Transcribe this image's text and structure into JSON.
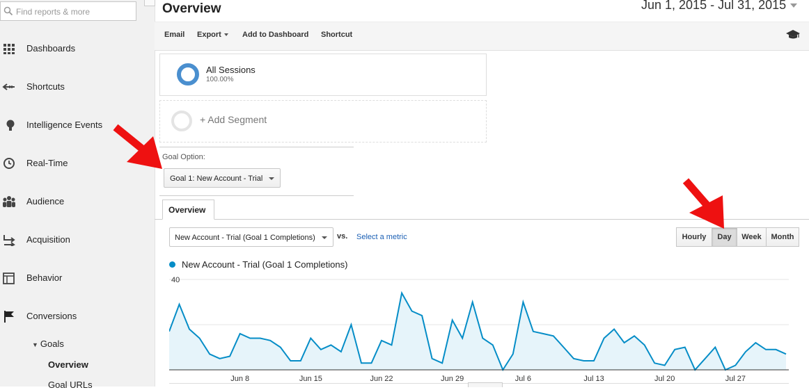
{
  "sidebar": {
    "search_placeholder": "Find reports & more",
    "items": [
      {
        "label": "Dashboards",
        "icon": "grid-icon"
      },
      {
        "label": "Shortcuts",
        "icon": "shortcut-arrow-icon"
      },
      {
        "label": "Intelligence Events",
        "icon": "lightbulb-icon"
      },
      {
        "label": "Real-Time",
        "icon": "clock-icon"
      },
      {
        "label": "Audience",
        "icon": "people-icon"
      },
      {
        "label": "Acquisition",
        "icon": "arrows-icon"
      },
      {
        "label": "Behavior",
        "icon": "layout-icon"
      },
      {
        "label": "Conversions",
        "icon": "flag-icon"
      }
    ],
    "goals_label": "Goals",
    "goals_items": [
      "Overview",
      "Goal URLs"
    ]
  },
  "header": {
    "title": "Overview",
    "date_range": "Jun 1, 2015 - Jul 31, 2015"
  },
  "toolbar": {
    "email": "Email",
    "export": "Export",
    "add_to_dashboard": "Add to Dashboard",
    "shortcut": "Shortcut"
  },
  "segments": {
    "all_sessions": "All Sessions",
    "all_sessions_pct": "100.00%",
    "add_segment": "+ Add Segment"
  },
  "goal_option": {
    "label": "Goal Option:",
    "value": "Goal 1: New Account - Trial"
  },
  "tabs": {
    "overview": "Overview"
  },
  "metric": {
    "selected": "New Account - Trial (Goal 1 Completions)",
    "vs": "vs.",
    "select_metric": "Select a metric"
  },
  "granularity": [
    "Hourly",
    "Day",
    "Week",
    "Month"
  ],
  "granularity_active": "Day",
  "colors": {
    "series": "#058dc7",
    "area": "#e6f4fa",
    "arrow": "#ee1111"
  },
  "chart_data": {
    "type": "area",
    "title": "",
    "series": [
      {
        "name": "New Account - Trial (Goal 1 Completions)",
        "values": [
          17,
          29,
          18,
          14,
          7,
          5,
          6,
          16,
          14,
          14,
          13,
          10,
          4,
          4,
          14,
          9,
          11,
          8,
          20,
          3,
          3,
          13,
          11,
          34,
          26,
          24,
          5,
          3,
          22,
          14,
          30,
          14,
          11,
          0,
          7,
          30,
          17,
          16,
          15,
          10,
          5,
          4,
          4,
          14,
          18,
          12,
          15,
          11,
          3,
          2,
          9,
          10,
          0,
          5,
          10,
          0,
          2,
          8,
          12,
          9,
          9,
          7
        ]
      }
    ],
    "x_start": "Jun 1",
    "tick_labels": [
      "Jun 8",
      "Jun 15",
      "Jun 22",
      "Jun 29",
      "Jul 6",
      "Jul 13",
      "Jul 20",
      "Jul 27"
    ],
    "y_ticks": [
      20,
      40
    ],
    "ylim": [
      0,
      40
    ],
    "grid": true
  }
}
